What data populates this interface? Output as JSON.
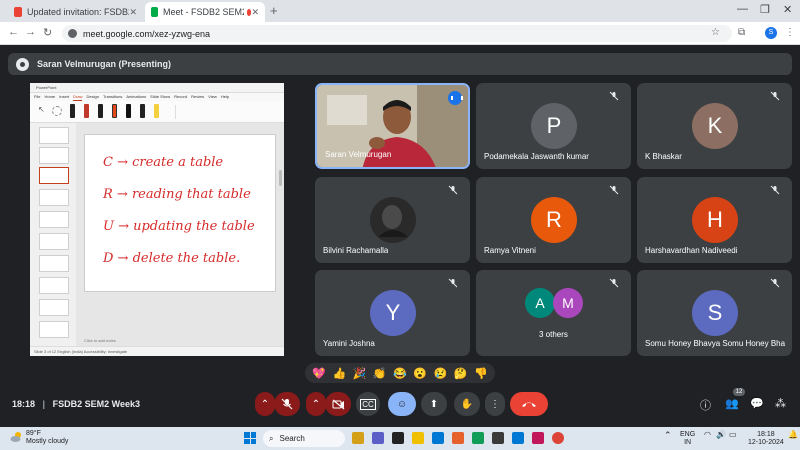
{
  "browser": {
    "tabs": [
      {
        "label": "Updated invitation: FSDB2 SEM",
        "active": false
      },
      {
        "label": "Meet - FSDB2 SEM2 Week3",
        "active": true
      }
    ],
    "new_tab": "+",
    "url": "meet.google.com/xez-yzwg-ena",
    "profile_initial": "S"
  },
  "presenter": {
    "label": "Saran Velmurugan (Presenting)"
  },
  "shared_screen": {
    "app_title": "PowerPoint",
    "menu": [
      "File",
      "Home",
      "Insert",
      "Draw",
      "Design",
      "Transitions",
      "Animations",
      "Slide Show",
      "Record",
      "Review",
      "View",
      "Help"
    ],
    "active_menu": "Draw",
    "slide_lines": [
      "C → create a table",
      "R → reading that table",
      "U → updating the table",
      "D → delete the table."
    ],
    "notes_placeholder": "Click to add notes",
    "status": "Slide 3 of 12   English (India)   Accessibility: Investigate"
  },
  "participants": [
    {
      "name": "Saran Velmurugan",
      "type": "video",
      "speaking": true
    },
    {
      "name": "Podamekala Jaswanth kumar",
      "initial": "P",
      "color": "#5f6368",
      "muted": true
    },
    {
      "name": "K Bhaskar",
      "initial": "K",
      "color": "#8d6e63",
      "muted": true
    },
    {
      "name": "Bilvini Rachamalla",
      "type": "photo",
      "muted": true
    },
    {
      "name": "Ramya Vitneni",
      "initial": "R",
      "color": "#e8590c",
      "muted": true
    },
    {
      "name": "Harshavardhan Nadiveedi",
      "initial": "H",
      "color": "#d84315",
      "muted": true
    },
    {
      "name": "Yamini Joshna",
      "initial": "Y",
      "color": "#5c6bc0",
      "muted": true
    },
    {
      "name": "3 others",
      "type": "group",
      "initials": [
        "A",
        "M"
      ],
      "colors": [
        "#00897b",
        "#ab47bc"
      ],
      "muted": true
    },
    {
      "name": "Somu Honey Bhavya Somu Honey Bha...",
      "initial": "S",
      "color": "#5c6bc0",
      "muted": true
    }
  ],
  "reactions": [
    "💖",
    "👍",
    "🎉",
    "👏",
    "😂",
    "😮",
    "😢",
    "🤔",
    "👎"
  ],
  "meeting_info": {
    "time": "18:18",
    "separator": "|",
    "name": "FSDB2 SEM2 Week3"
  },
  "people_count": "12",
  "taskbar": {
    "weather_temp": "89°F",
    "weather_desc": "Mostly cloudy",
    "search_label": "Search",
    "lang_top": "ENG",
    "lang_bottom": "IN",
    "clock_time": "18:18",
    "clock_date": "12-10-2024"
  },
  "colors": {
    "meet_bg": "#202124",
    "tile_bg": "#3c4043",
    "end_call": "#ea4335",
    "accent_blue": "#8ab4f8",
    "ink_red": "#d62b2b"
  }
}
